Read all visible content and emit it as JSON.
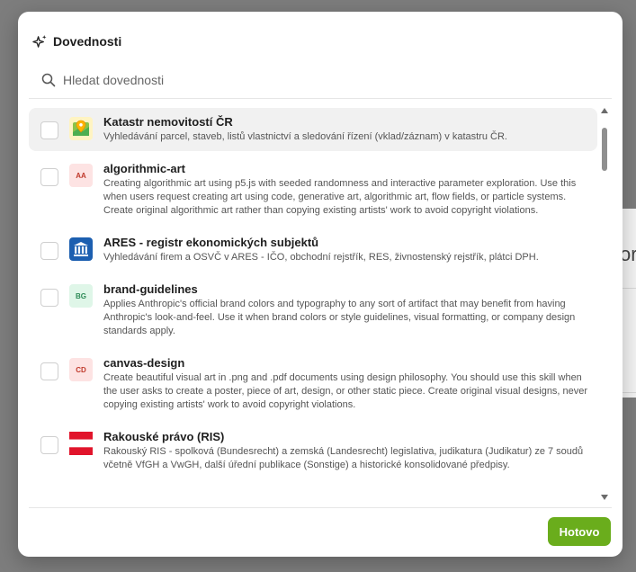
{
  "background": {
    "fragment_text": "or"
  },
  "dialog": {
    "title": "Dovednosti",
    "search": {
      "placeholder": "Hledat dovednosti",
      "value": ""
    },
    "done_label": "Hotovo",
    "accent": "#6aad1c"
  },
  "skills": [
    {
      "name": "Katastr nemovitostí ČR",
      "desc": "Vyhledávání parcel, staveb, listů vlastnictví a sledování řízení (vklad/záznam) v katastru ČR.",
      "icon": "map-pin-icon",
      "checked": false
    },
    {
      "name": "algorithmic-art",
      "desc": "Creating algorithmic art using p5.js with seeded randomness and interactive parameter exploration. Use this when users request creating art using code, generative art, algorithmic art, flow fields, or particle systems. Create original algorithmic art rather than copying existing artists' work to avoid copyright violations.",
      "icon": "AA",
      "checked": false
    },
    {
      "name": "ARES - registr ekonomických subjektů",
      "desc": "Vyhledávání firem a OSVČ v ARES - IČO, obchodní rejstřík, RES, živnostenský rejstřík, plátci DPH.",
      "icon": "institution-icon",
      "checked": false
    },
    {
      "name": "brand-guidelines",
      "desc": "Applies Anthropic's official brand colors and typography to any sort of artifact that may benefit from having Anthropic's look-and-feel. Use it when brand colors or style guidelines, visual formatting, or company design standards apply.",
      "icon": "BG",
      "checked": false
    },
    {
      "name": "canvas-design",
      "desc": "Create beautiful visual art in .png and .pdf documents using design philosophy. You should use this skill when the user asks to create a poster, piece of art, design, or other static piece. Create original visual designs, never copying existing artists' work to avoid copyright violations.",
      "icon": "CD",
      "checked": false
    },
    {
      "name": "Rakouské právo (RIS)",
      "desc": "Rakouský RIS - spolková (Bundesrecht) a zemská (Landesrecht) legislativa, judikatura (Judikatur) ze 7 soudů včetně VfGH a VwGH, další úřední publikace (Sonstige) a historické konsolidované předpisy.",
      "icon": "austria-flag-icon",
      "checked": false
    }
  ]
}
